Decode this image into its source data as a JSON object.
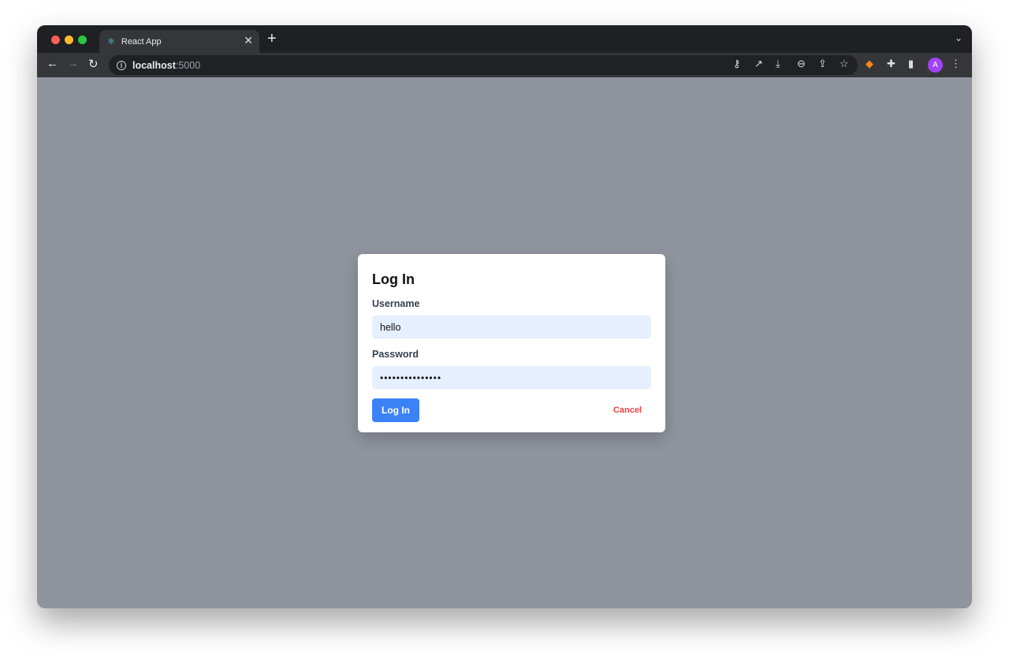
{
  "browser": {
    "tab_title": "React App",
    "url_host": "localhost",
    "url_port": ":5000",
    "avatar_letter": "A"
  },
  "dialog": {
    "title": "Log In",
    "username_label": "Username",
    "username_value": "hello",
    "password_label": "Password",
    "password_value": "•••••••••••••••",
    "login_label": "Log In",
    "cancel_label": "Cancel"
  },
  "colors": {
    "accent": "#3b82f6",
    "danger": "#ef4444",
    "overlay": "#8f949e"
  }
}
